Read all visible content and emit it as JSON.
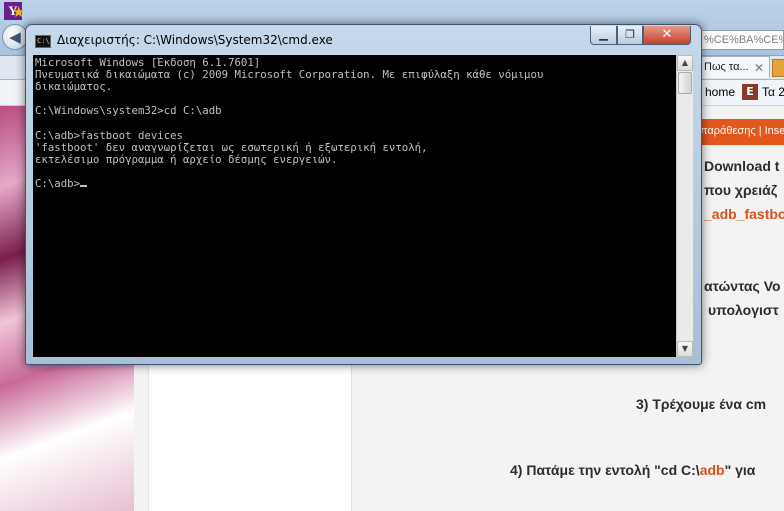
{
  "browser": {
    "back_icon": "back-arrow-icon",
    "url_fragment": "%CE%BA%CE%",
    "tab_fragment": "Πως τα...",
    "fav_home": "home",
    "fav_link2": "Τα 2",
    "page": {
      "orange_menu": "παράθεσης | Inse",
      "line_download": "Download t",
      "line_needed": "που χρειάζ",
      "line_adb": "_adb_fastbo",
      "line_pressing": "ατώντας Vo",
      "line_computer": "υπολογιστ",
      "step3": "3) Τρέχουμε ένα cm",
      "step4_pre": "4) Πατάμε την εντολή \"cd C:\\",
      "step4_adb": "adb",
      "step4_post": "\" για"
    }
  },
  "cmd": {
    "title": "Διαχειριστής: C:\\Windows\\System32\\cmd.exe",
    "lines": [
      "Microsoft Windows [Έκδοση 6.1.7601]",
      "Πνευματικά δικαιώματα (c) 2009 Microsoft Corporation. Με επιφύλαξη κάθε νόμιμου",
      "δικαιώματος.",
      "",
      "C:\\Windows\\system32>cd C:\\adb",
      "",
      "C:\\adb>fastboot devices",
      "'fastboot' δεν αναγνωρίζεται ως εσωτερική ή εξωτερική εντολή,",
      "εκτελέσιμο πρόγραμμα ή αρχείο δέσμης ενεργειών.",
      "",
      "C:\\adb>"
    ]
  }
}
